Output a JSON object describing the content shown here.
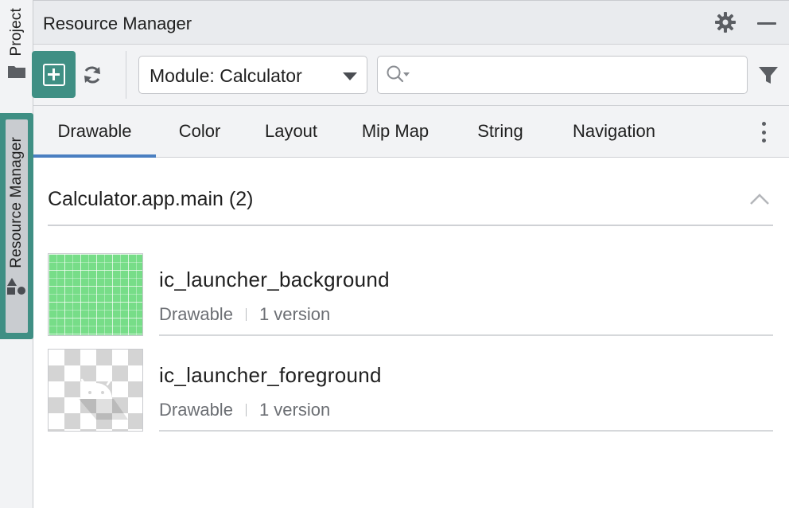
{
  "tool_strip": {
    "project_label": "Project",
    "resource_manager_label": "Resource Manager"
  },
  "header": {
    "title": "Resource Manager"
  },
  "toolbar": {
    "module_selected": "Module: Calculator",
    "search_placeholder": ""
  },
  "tabs": [
    {
      "label": "Drawable",
      "active": true
    },
    {
      "label": "Color",
      "active": false
    },
    {
      "label": "Layout",
      "active": false
    },
    {
      "label": "Mip Map",
      "active": false
    },
    {
      "label": "String",
      "active": false
    },
    {
      "label": "Navigation",
      "active": false
    }
  ],
  "group": {
    "title": "Calculator.app.main (2)"
  },
  "resources": [
    {
      "name": "ic_launcher_background",
      "type": "Drawable",
      "versions": "1 version"
    },
    {
      "name": "ic_launcher_foreground",
      "type": "Drawable",
      "versions": "1 version"
    }
  ],
  "colors": {
    "accent": "#3f8f84",
    "tab_indicator": "#4a7fc1",
    "thumb_green": "#77dd88"
  }
}
